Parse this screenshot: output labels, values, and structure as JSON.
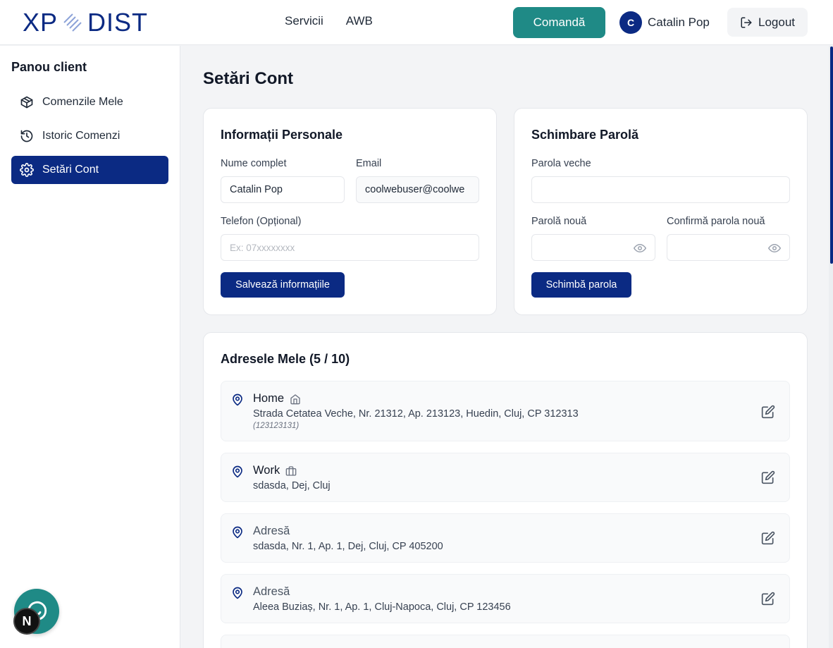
{
  "header": {
    "logo_left": "XP",
    "logo_right": "DIST",
    "nav": [
      "Servicii",
      "AWB"
    ],
    "order_button": "Comandă",
    "user_initial": "C",
    "user_name": "Catalin Pop",
    "logout_label": "Logout"
  },
  "sidebar": {
    "title": "Panou client",
    "items": [
      {
        "label": "Comenzile Mele",
        "icon": "package-icon",
        "active": false
      },
      {
        "label": "Istoric Comenzi",
        "icon": "history-icon",
        "active": false
      },
      {
        "label": "Setări Cont",
        "icon": "gear-icon",
        "active": true
      }
    ]
  },
  "page": {
    "title": "Setări Cont"
  },
  "personal": {
    "title": "Informații Personale",
    "name_label": "Nume complet",
    "name_value": "Catalin Pop",
    "email_label": "Email",
    "email_value": "coolwebuser@coolwe",
    "phone_label": "Telefon (Opțional)",
    "phone_placeholder": "Ex: 07xxxxxxxx",
    "save_button": "Salvează informațiile"
  },
  "password": {
    "title": "Schimbare Parolă",
    "old_label": "Parola veche",
    "new_label": "Parolă nouă",
    "confirm_label": "Confirmă parola nouă",
    "change_button": "Schimbă parola"
  },
  "addresses": {
    "title": "Adresele Mele (5 / 10)",
    "items": [
      {
        "name": "Home",
        "type_icon": "home-icon",
        "line": "Strada Cetatea Veche, Nr. 21312, Ap. 213123, Huedin, Cluj, CP 312313",
        "note": "(123123131)"
      },
      {
        "name": "Work",
        "type_icon": "briefcase-icon",
        "line": "sdasda, Dej, Cluj",
        "note": ""
      },
      {
        "name": "Adresă",
        "type_icon": "",
        "line": "sdasda, Nr. 1, Ap. 1, Dej, Cluj, CP 405200",
        "note": ""
      },
      {
        "name": "Adresă",
        "type_icon": "",
        "line": "Aleea Buziaș, Nr. 1, Ap. 1, Cluj-Napoca, Cluj, CP 123456",
        "note": ""
      }
    ]
  },
  "floating": {
    "next_badge": "N"
  },
  "colors": {
    "brand": "#0b2a83",
    "accent": "#1f8a86",
    "background": "#f3f4f6"
  }
}
